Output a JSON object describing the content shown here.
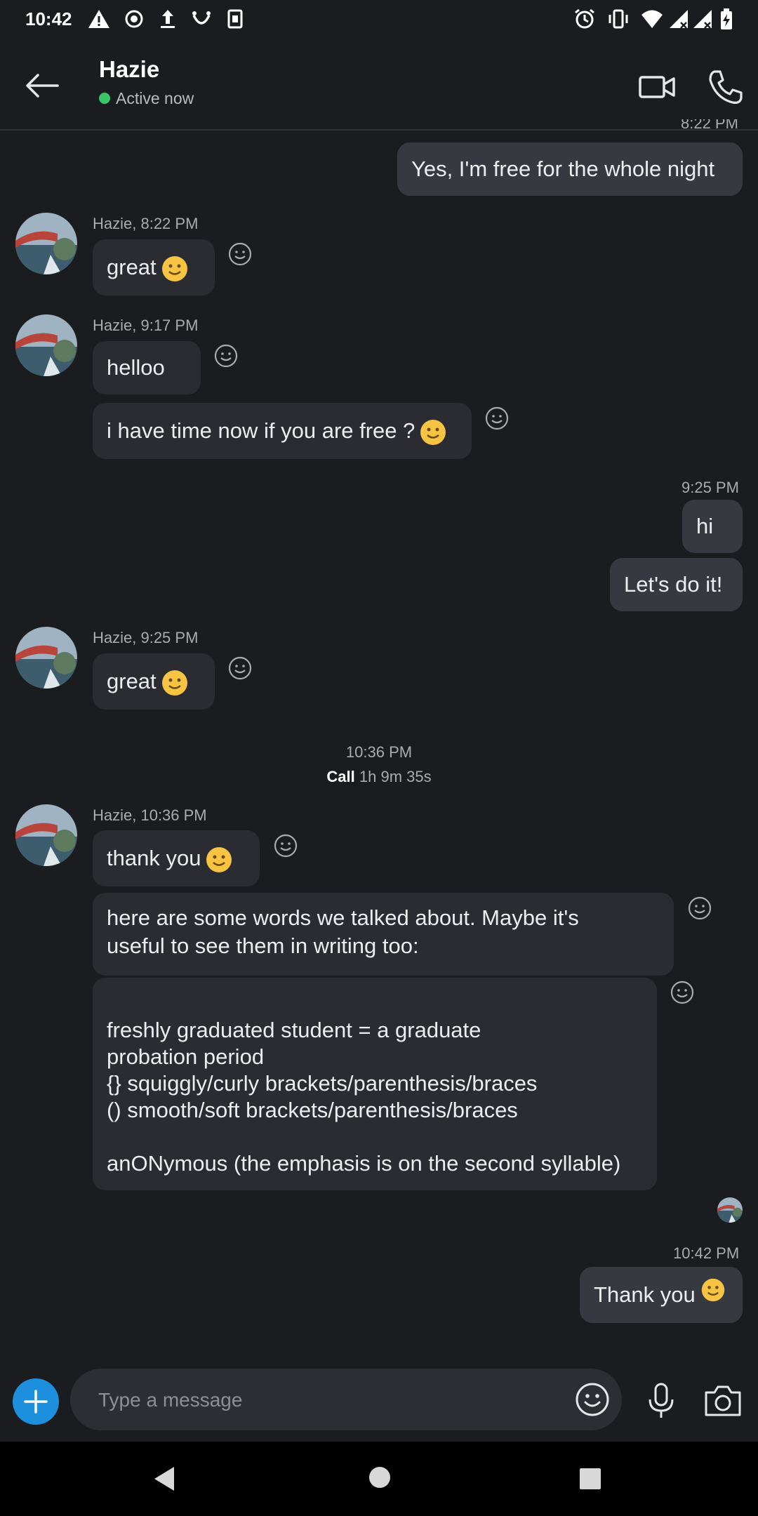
{
  "status_bar": {
    "time": "10:42"
  },
  "header": {
    "contact_name": "Hazie",
    "presence": "Active now"
  },
  "messages": {
    "top_partial_time": "8:22 PM",
    "out1": "Yes, I'm free for the whole night",
    "meta1": "Hazie, 8:22 PM",
    "in1": "great",
    "meta2": "Hazie, 9:17 PM",
    "in2": "helloo",
    "in3": "i have time now if you are free ?",
    "meta3": "9:25 PM",
    "out2": "hi",
    "out3": "Let's do it!",
    "meta4": "Hazie, 9:25 PM",
    "in4": "great",
    "call_time": "10:36 PM",
    "call_label": "Call",
    "call_duration": "1h 9m 35s",
    "meta5": "Hazie, 10:36 PM",
    "in5": "thank you",
    "in6_line1": "here are some words we talked about. Maybe it's",
    "in6_line2": "useful to see them in writing too:",
    "in7_lines": [
      "freshly graduated student = a graduate",
      "probation period",
      "{} squiggly/curly brackets/parenthesis/braces",
      "() smooth/soft brackets/parenthesis/braces",
      "anONymous (the emphasis is on the second syllable)"
    ],
    "meta6": "10:42 PM",
    "out4": "Thank you"
  },
  "composer": {
    "placeholder": "Type a message"
  },
  "colors": {
    "background": "#1b1c20",
    "incoming_bubble": "#2a2c31",
    "outgoing_bubble": "#363a40",
    "accent": "#1e8fdc",
    "presence_green": "#39c466",
    "emoji_yellow": "#f6c343"
  },
  "icons": {
    "back": "arrow-left-icon",
    "video": "video-camera-icon",
    "call": "phone-icon",
    "react": "smiley-outline-icon",
    "add": "plus-icon",
    "emoji": "emoji-icon",
    "mic": "microphone-icon",
    "camera": "camera-icon"
  }
}
